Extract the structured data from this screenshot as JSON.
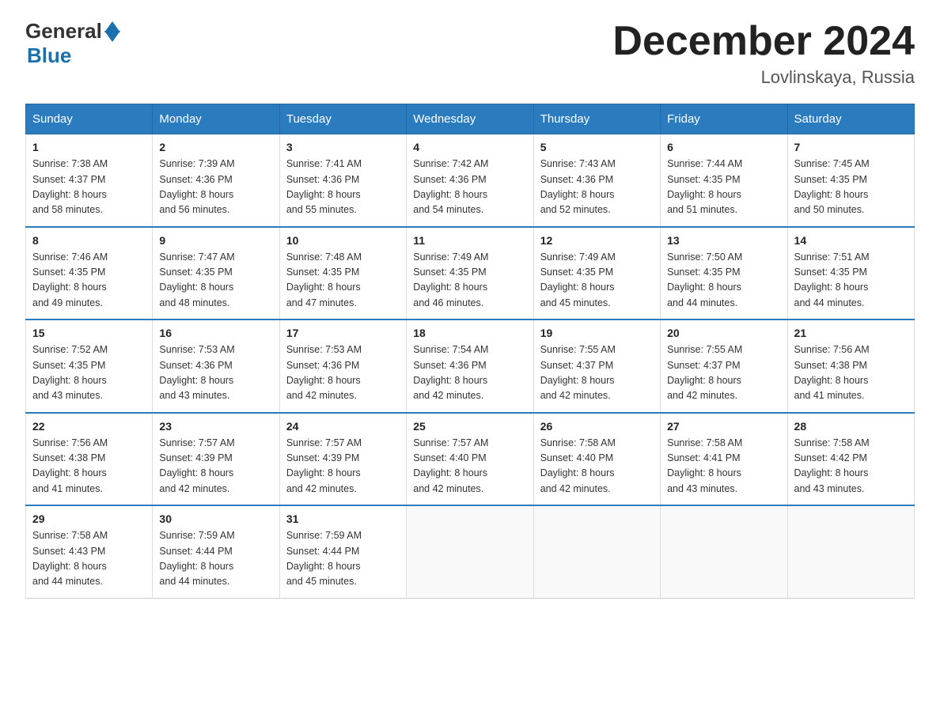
{
  "header": {
    "logo_general": "General",
    "logo_blue": "Blue",
    "title": "December 2024",
    "location": "Lovlinskaya, Russia"
  },
  "days_of_week": [
    "Sunday",
    "Monday",
    "Tuesday",
    "Wednesday",
    "Thursday",
    "Friday",
    "Saturday"
  ],
  "weeks": [
    [
      {
        "day": "1",
        "sunrise": "7:38 AM",
        "sunset": "4:37 PM",
        "daylight": "8 hours and 58 minutes."
      },
      {
        "day": "2",
        "sunrise": "7:39 AM",
        "sunset": "4:36 PM",
        "daylight": "8 hours and 56 minutes."
      },
      {
        "day": "3",
        "sunrise": "7:41 AM",
        "sunset": "4:36 PM",
        "daylight": "8 hours and 55 minutes."
      },
      {
        "day": "4",
        "sunrise": "7:42 AM",
        "sunset": "4:36 PM",
        "daylight": "8 hours and 54 minutes."
      },
      {
        "day": "5",
        "sunrise": "7:43 AM",
        "sunset": "4:36 PM",
        "daylight": "8 hours and 52 minutes."
      },
      {
        "day": "6",
        "sunrise": "7:44 AM",
        "sunset": "4:35 PM",
        "daylight": "8 hours and 51 minutes."
      },
      {
        "day": "7",
        "sunrise": "7:45 AM",
        "sunset": "4:35 PM",
        "daylight": "8 hours and 50 minutes."
      }
    ],
    [
      {
        "day": "8",
        "sunrise": "7:46 AM",
        "sunset": "4:35 PM",
        "daylight": "8 hours and 49 minutes."
      },
      {
        "day": "9",
        "sunrise": "7:47 AM",
        "sunset": "4:35 PM",
        "daylight": "8 hours and 48 minutes."
      },
      {
        "day": "10",
        "sunrise": "7:48 AM",
        "sunset": "4:35 PM",
        "daylight": "8 hours and 47 minutes."
      },
      {
        "day": "11",
        "sunrise": "7:49 AM",
        "sunset": "4:35 PM",
        "daylight": "8 hours and 46 minutes."
      },
      {
        "day": "12",
        "sunrise": "7:49 AM",
        "sunset": "4:35 PM",
        "daylight": "8 hours and 45 minutes."
      },
      {
        "day": "13",
        "sunrise": "7:50 AM",
        "sunset": "4:35 PM",
        "daylight": "8 hours and 44 minutes."
      },
      {
        "day": "14",
        "sunrise": "7:51 AM",
        "sunset": "4:35 PM",
        "daylight": "8 hours and 44 minutes."
      }
    ],
    [
      {
        "day": "15",
        "sunrise": "7:52 AM",
        "sunset": "4:35 PM",
        "daylight": "8 hours and 43 minutes."
      },
      {
        "day": "16",
        "sunrise": "7:53 AM",
        "sunset": "4:36 PM",
        "daylight": "8 hours and 43 minutes."
      },
      {
        "day": "17",
        "sunrise": "7:53 AM",
        "sunset": "4:36 PM",
        "daylight": "8 hours and 42 minutes."
      },
      {
        "day": "18",
        "sunrise": "7:54 AM",
        "sunset": "4:36 PM",
        "daylight": "8 hours and 42 minutes."
      },
      {
        "day": "19",
        "sunrise": "7:55 AM",
        "sunset": "4:37 PM",
        "daylight": "8 hours and 42 minutes."
      },
      {
        "day": "20",
        "sunrise": "7:55 AM",
        "sunset": "4:37 PM",
        "daylight": "8 hours and 42 minutes."
      },
      {
        "day": "21",
        "sunrise": "7:56 AM",
        "sunset": "4:38 PM",
        "daylight": "8 hours and 41 minutes."
      }
    ],
    [
      {
        "day": "22",
        "sunrise": "7:56 AM",
        "sunset": "4:38 PM",
        "daylight": "8 hours and 41 minutes."
      },
      {
        "day": "23",
        "sunrise": "7:57 AM",
        "sunset": "4:39 PM",
        "daylight": "8 hours and 42 minutes."
      },
      {
        "day": "24",
        "sunrise": "7:57 AM",
        "sunset": "4:39 PM",
        "daylight": "8 hours and 42 minutes."
      },
      {
        "day": "25",
        "sunrise": "7:57 AM",
        "sunset": "4:40 PM",
        "daylight": "8 hours and 42 minutes."
      },
      {
        "day": "26",
        "sunrise": "7:58 AM",
        "sunset": "4:40 PM",
        "daylight": "8 hours and 42 minutes."
      },
      {
        "day": "27",
        "sunrise": "7:58 AM",
        "sunset": "4:41 PM",
        "daylight": "8 hours and 43 minutes."
      },
      {
        "day": "28",
        "sunrise": "7:58 AM",
        "sunset": "4:42 PM",
        "daylight": "8 hours and 43 minutes."
      }
    ],
    [
      {
        "day": "29",
        "sunrise": "7:58 AM",
        "sunset": "4:43 PM",
        "daylight": "8 hours and 44 minutes."
      },
      {
        "day": "30",
        "sunrise": "7:59 AM",
        "sunset": "4:44 PM",
        "daylight": "8 hours and 44 minutes."
      },
      {
        "day": "31",
        "sunrise": "7:59 AM",
        "sunset": "4:44 PM",
        "daylight": "8 hours and 45 minutes."
      },
      null,
      null,
      null,
      null
    ]
  ],
  "labels": {
    "sunrise": "Sunrise:",
    "sunset": "Sunset:",
    "daylight": "Daylight:"
  }
}
